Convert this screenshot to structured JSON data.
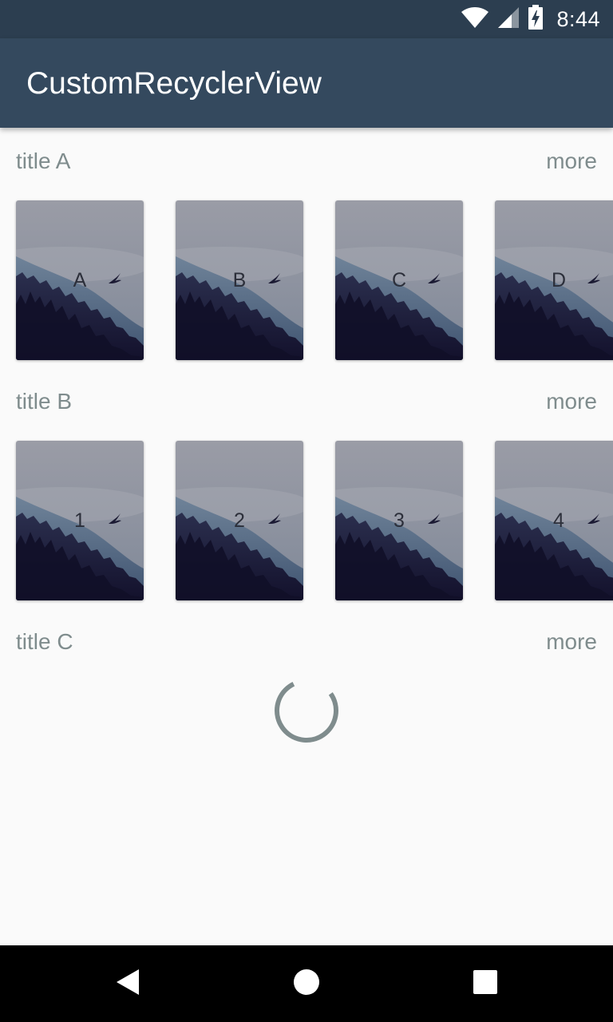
{
  "status_bar": {
    "time": "8:44",
    "icons": [
      "wifi-icon",
      "cellular-signal-icon",
      "battery-charging-icon"
    ]
  },
  "app_bar": {
    "title": "CustomRecyclerView"
  },
  "sections": [
    {
      "title": "title A",
      "more_label": "more",
      "cards": [
        {
          "label": "A"
        },
        {
          "label": "B"
        },
        {
          "label": "C"
        },
        {
          "label": "D"
        }
      ]
    },
    {
      "title": "title B",
      "more_label": "more",
      "cards": [
        {
          "label": "1"
        },
        {
          "label": "2"
        },
        {
          "label": "3"
        },
        {
          "label": "4"
        }
      ]
    },
    {
      "title": "title C",
      "more_label": "more",
      "loading": true
    }
  ],
  "nav_bar": {
    "buttons": [
      "back-icon",
      "home-icon",
      "recents-icon"
    ]
  },
  "colors": {
    "status_bar": "#2c3e50",
    "app_bar": "#34495e",
    "background": "#fafafa",
    "section_text": "#7f8c8d",
    "spinner": "#7f8c8d"
  }
}
